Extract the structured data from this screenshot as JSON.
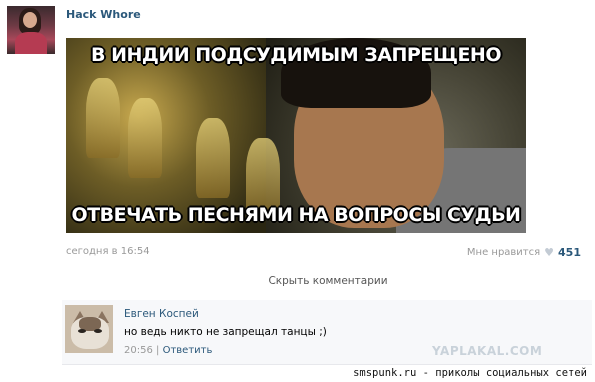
{
  "post": {
    "author": "Hack Whore",
    "meme_top": "В ИНДИИ ПОДСУДИМЫМ ЗАПРЕЩЕНО",
    "meme_bottom": "ОТВЕЧАТЬ ПЕСНЯМИ НА ВОПРОСЫ СУДЬИ",
    "date": "сегодня в 16:54",
    "likes_label": "Мне нравится",
    "likes_count": "451",
    "heart_icon": "heart-icon"
  },
  "comments": {
    "toggle_label": "Скрыть комментарии",
    "items": [
      {
        "name": "Евген Коспей",
        "text": "но ведь никто не запрещал танцы ;)",
        "time": "20:56",
        "separator": "|",
        "reply_label": "Ответить"
      }
    ]
  },
  "watermarks": {
    "yaplakal": "YAPLAKAL.COM",
    "footer": "smspunk.ru - приколы социальных сетей"
  }
}
